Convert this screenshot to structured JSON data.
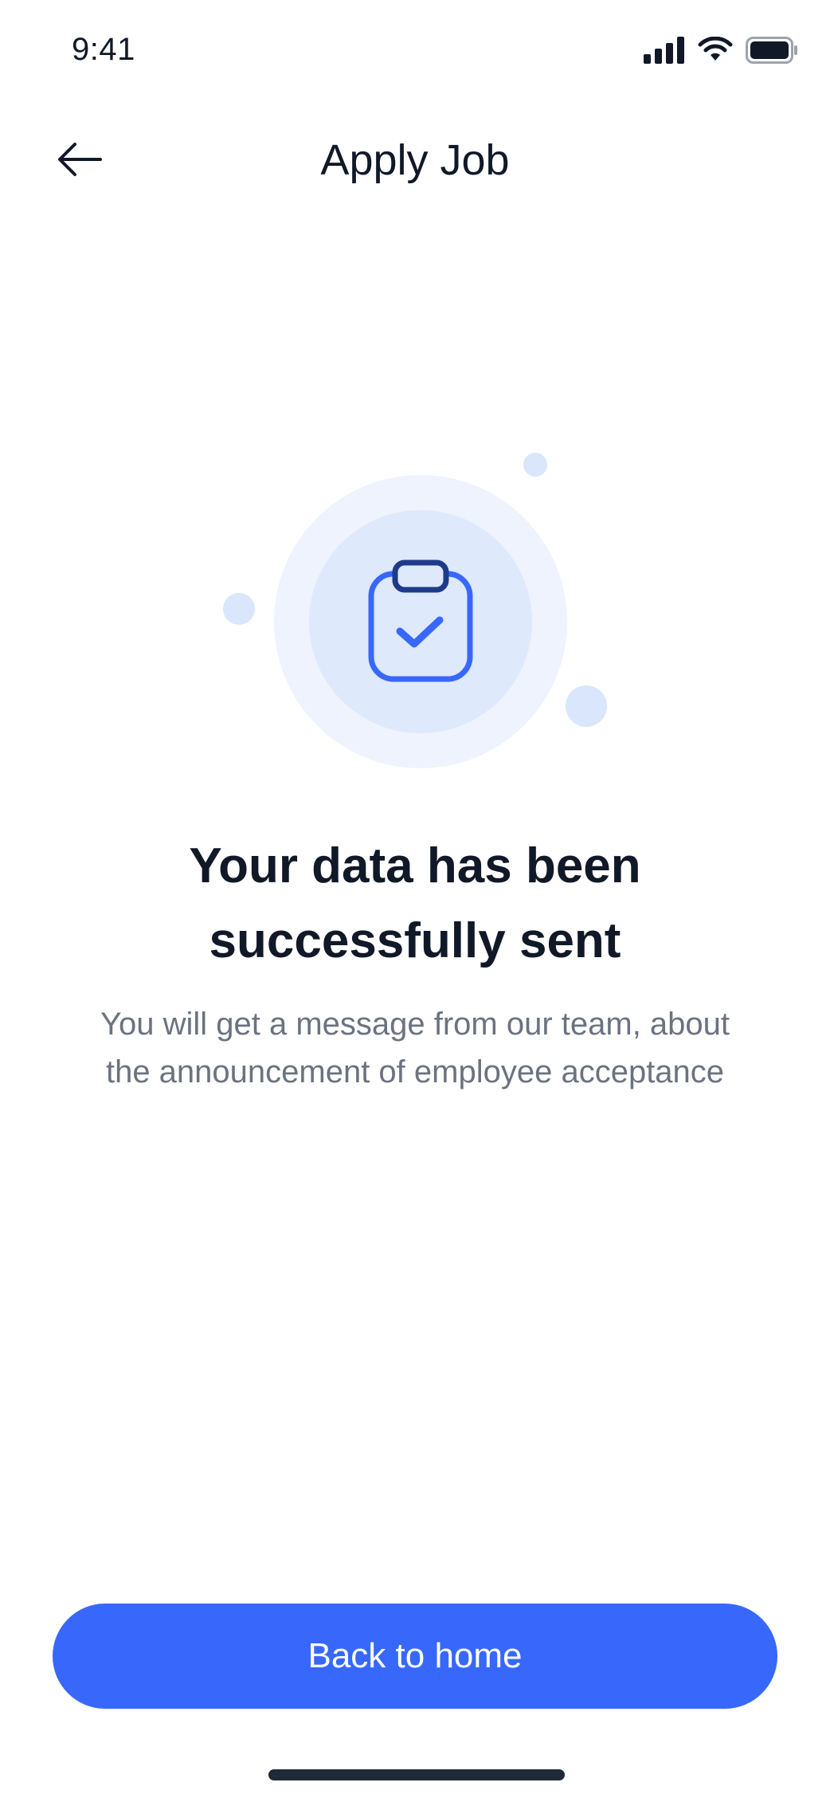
{
  "status_bar": {
    "time": "9:41",
    "icons": [
      "cellular-signal-icon",
      "wifi-icon",
      "battery-icon"
    ]
  },
  "header": {
    "title": "Apply Job",
    "back_icon": "arrow-left-icon"
  },
  "illustration": {
    "icon": "clipboard-check-icon",
    "colors": {
      "outer_ring": "#eef3fd",
      "inner_ring": "#dfe9fc",
      "accent": "#3768fb",
      "clip": "#1e3a8a"
    }
  },
  "message": {
    "headline_line1": "Your data has been",
    "headline_line2": "successfully sent",
    "body_line1": "You will get a message from our team, about",
    "body_line2": "the announcement of employee acceptance"
  },
  "actions": {
    "back_home_label": "Back to home"
  },
  "colors": {
    "primary": "#3768fb",
    "text_primary": "#111827",
    "text_secondary": "#6b7280"
  }
}
